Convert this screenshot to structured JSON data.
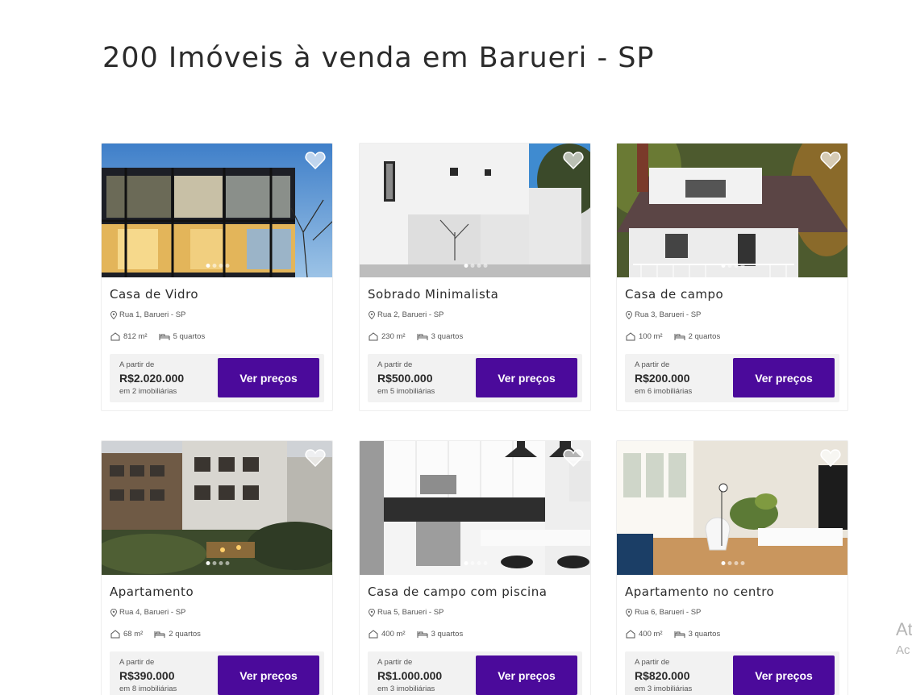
{
  "page": {
    "title": "200 Imóveis à venda em Barueri - SP"
  },
  "listings": [
    {
      "name": "Casa de Vidro",
      "address": "Rua 1, Barueri - SP",
      "area": "812 m²",
      "rooms": "5 quartos",
      "from_label": "A partir de",
      "price": "R$2.020.000",
      "agencies": "em 2 imobiliárias",
      "button": "Ver preços",
      "photo": "glass-house-night"
    },
    {
      "name": "Sobrado Minimalista",
      "address": "Rua 2, Barueri - SP",
      "area": "230 m²",
      "rooms": "3 quartos",
      "from_label": "A partir de",
      "price": "R$500.000",
      "agencies": "em 5 imobiliárias",
      "button": "Ver preços",
      "photo": "white-minimalist-house"
    },
    {
      "name": "Casa de campo",
      "address": "Rua 3, Barueri - SP",
      "area": "100 m²",
      "rooms": "2 quartos",
      "from_label": "A partir de",
      "price": "R$200.000",
      "agencies": "em 6 imobiliárias",
      "button": "Ver preços",
      "photo": "country-house"
    },
    {
      "name": "Apartamento",
      "address": "Rua 4, Barueri - SP",
      "area": "68 m²",
      "rooms": "2 quartos",
      "from_label": "A partir de",
      "price": "R$390.000",
      "agencies": "em 8 imobiliárias",
      "button": "Ver preços",
      "photo": "apartment-complex"
    },
    {
      "name": "Casa de campo com piscina",
      "address": "Rua 5, Barueri - SP",
      "area": "400 m²",
      "rooms": "3 quartos",
      "from_label": "A partir de",
      "price": "R$1.000.000",
      "agencies": "em 3 imobiliárias",
      "button": "Ver preços",
      "photo": "white-kitchen"
    },
    {
      "name": "Apartamento no centro",
      "address": "Rua 6, Barueri - SP",
      "area": "400 m²",
      "rooms": "3 quartos",
      "from_label": "A partir de",
      "price": "R$820.000",
      "agencies": "em 3 imobiliárias",
      "button": "Ver preços",
      "photo": "bright-living-room"
    }
  ],
  "icons": {
    "favorite": "heart-icon",
    "location": "map-pin-icon",
    "area": "house-outline-icon",
    "rooms": "bed-icon"
  },
  "colors": {
    "accent": "#4b0a9b",
    "price_box": "#f2f2f2"
  },
  "watermark": {
    "line1": "At",
    "line2": "Ac"
  }
}
